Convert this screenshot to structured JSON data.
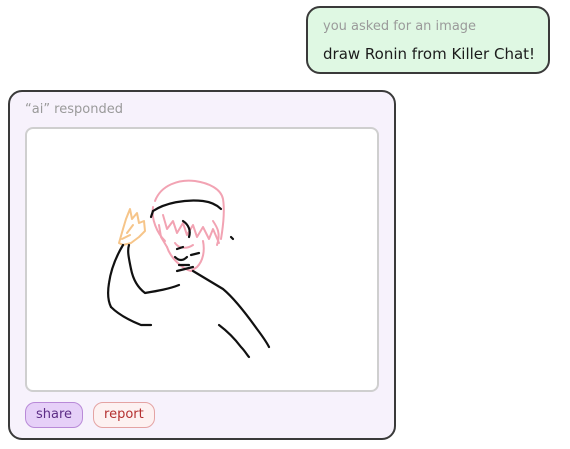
{
  "request": {
    "caption": "you asked for an image",
    "prompt": "draw Ronin from Killer Chat!"
  },
  "response": {
    "caption": "“ai” responded",
    "image": {
      "subject": "hand-drawn doodle of a figure in a cap waving",
      "colors": {
        "ink": "#111111",
        "hair": "#f2a3b3",
        "hand": "#f6c58a"
      }
    },
    "actions": {
      "share_label": "share",
      "report_label": "report"
    }
  },
  "colors": {
    "request_bg": "#dff8e3",
    "response_bg": "#f7f2fc",
    "border": "#3a3a3a",
    "share_bg": "#e6d0f8",
    "report_bg": "#fdf1f1"
  }
}
